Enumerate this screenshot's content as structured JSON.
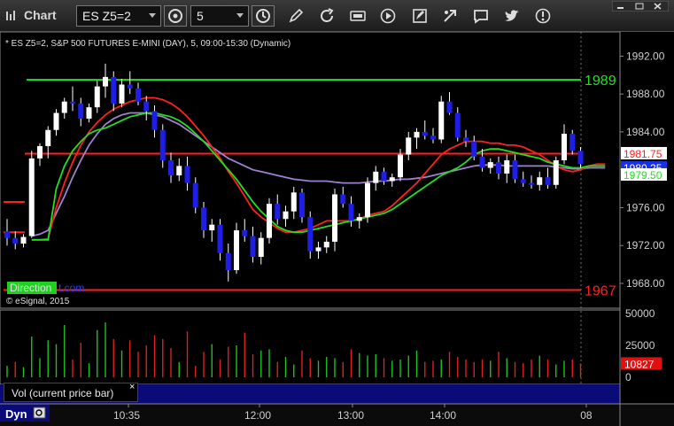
{
  "window": {
    "title": "Chart",
    "symbol": "ES Z5=2",
    "interval": "5"
  },
  "toolbar_icons": [
    "interval-settings-icon",
    "clock-icon",
    "draw-pencil-icon",
    "refresh-icon",
    "get-icon",
    "play-icon",
    "link-icon",
    "chat-icon",
    "twitter-icon",
    "window-controls-icon"
  ],
  "chart_info": {
    "description": "* ES Z5=2, S&P 500 FUTURES E-MINI (DAY), 5, 09:00-15:30 (Dynamic)",
    "copyright": "© eSignal, 2015",
    "direction_badge": "Direction",
    "direction_suffix": "t.com"
  },
  "colors": {
    "bull_candle": "#ffffff",
    "bear_candle": "#1e1ee6",
    "line_red": "#ff2020",
    "line_green": "#20e020",
    "line_purple": "#a080d0",
    "vol_up": "#20c020",
    "vol_down": "#e02020",
    "panel_blue": "#0a0a78"
  },
  "bottom": {
    "dyn_label": "Dyn",
    "vol_label": "Vol (current price bar)",
    "vol_close": "×"
  },
  "chart_data": [
    {
      "type": "candlestick",
      "title": "",
      "y_axis_ticks": [
        "1992.00",
        "1988.00",
        "1984.00",
        "1980.00",
        "1976.00",
        "1972.00",
        "1968.00"
      ],
      "ylim": [
        1966.5,
        1994.0
      ],
      "x_axis_ticks": [
        "10:35",
        "12:00",
        "13:00",
        "14:00",
        "08"
      ],
      "horizontal_levels": [
        {
          "name": "1989",
          "value": 1989.5,
          "color": "#20e020",
          "labeled": true
        },
        {
          "name": "1967",
          "value": 1967.3,
          "color": "#ff2020",
          "labeled": true
        },
        {
          "name": "red-1981.7",
          "value": 1981.7,
          "color": "#ff2020",
          "labeled": false
        },
        {
          "name": "green-1981.7",
          "value": 1981.7,
          "color": "#20e020",
          "labeled": false
        }
      ],
      "price_labels": [
        {
          "text": "1981.75",
          "value": 1981.75,
          "color": "#ff2020"
        },
        {
          "text": "1980.25",
          "value": 1980.25,
          "color": "#2040ff"
        },
        {
          "text": "1979.50",
          "value": 1979.5,
          "color": "#20e020"
        }
      ],
      "candles": [
        [
          1973.5,
          1974.8,
          1972.0,
          1972.8
        ],
        [
          1972.8,
          1973.5,
          1971.6,
          1972.2
        ],
        [
          1972.2,
          1973.2,
          1971.8,
          1972.9
        ],
        [
          1973.0,
          1982.0,
          1972.8,
          1981.2
        ],
        [
          1981.2,
          1982.8,
          1980.4,
          1982.5
        ],
        [
          1982.5,
          1984.6,
          1981.2,
          1984.2
        ],
        [
          1984.2,
          1986.4,
          1983.6,
          1986.0
        ],
        [
          1986.0,
          1987.6,
          1985.4,
          1987.2
        ],
        [
          1987.2,
          1988.8,
          1986.2,
          1987.0
        ],
        [
          1987.0,
          1987.6,
          1984.6,
          1985.4
        ],
        [
          1985.4,
          1987.0,
          1985.0,
          1986.6
        ],
        [
          1986.6,
          1989.4,
          1986.0,
          1988.8
        ],
        [
          1988.8,
          1991.2,
          1987.6,
          1989.8
        ],
        [
          1989.8,
          1990.4,
          1986.2,
          1987.0
        ],
        [
          1987.0,
          1989.6,
          1986.6,
          1989.0
        ],
        [
          1989.0,
          1990.4,
          1988.0,
          1988.6
        ],
        [
          1988.6,
          1989.2,
          1986.8,
          1987.2
        ],
        [
          1987.2,
          1987.8,
          1985.2,
          1986.2
        ],
        [
          1986.2,
          1986.8,
          1983.4,
          1984.2
        ],
        [
          1984.2,
          1984.8,
          1980.2,
          1981.0
        ],
        [
          1981.0,
          1981.8,
          1978.6,
          1979.4
        ],
        [
          1979.4,
          1981.2,
          1978.8,
          1980.4
        ],
        [
          1980.4,
          1981.4,
          1977.8,
          1978.6
        ],
        [
          1978.6,
          1979.2,
          1975.4,
          1976.0
        ],
        [
          1976.0,
          1976.6,
          1972.8,
          1973.6
        ],
        [
          1973.6,
          1974.8,
          1972.4,
          1974.2
        ],
        [
          1974.2,
          1974.8,
          1970.4,
          1971.2
        ],
        [
          1971.2,
          1972.2,
          1968.2,
          1969.4
        ],
        [
          1969.4,
          1974.4,
          1969.0,
          1973.6
        ],
        [
          1973.6,
          1974.8,
          1972.4,
          1973.0
        ],
        [
          1973.0,
          1974.0,
          1970.2,
          1970.8
        ],
        [
          1970.8,
          1973.4,
          1970.0,
          1972.8
        ],
        [
          1972.8,
          1977.0,
          1972.2,
          1976.4
        ],
        [
          1976.4,
          1977.4,
          1974.2,
          1974.8
        ],
        [
          1974.8,
          1976.2,
          1974.0,
          1975.6
        ],
        [
          1975.6,
          1978.2,
          1974.8,
          1977.6
        ],
        [
          1977.6,
          1978.0,
          1974.4,
          1975.0
        ],
        [
          1975.0,
          1975.6,
          1970.6,
          1971.4
        ],
        [
          1971.4,
          1972.4,
          1970.6,
          1971.8
        ],
        [
          1971.8,
          1973.0,
          1971.2,
          1972.4
        ],
        [
          1972.4,
          1978.0,
          1971.4,
          1977.4
        ],
        [
          1977.4,
          1978.2,
          1976.0,
          1976.4
        ],
        [
          1976.4,
          1977.2,
          1974.0,
          1974.6
        ],
        [
          1974.6,
          1975.4,
          1973.8,
          1975.0
        ],
        [
          1975.0,
          1979.2,
          1974.4,
          1978.6
        ],
        [
          1978.6,
          1980.4,
          1977.8,
          1979.8
        ],
        [
          1979.8,
          1980.2,
          1978.4,
          1978.8
        ],
        [
          1978.8,
          1979.6,
          1978.2,
          1979.2
        ],
        [
          1979.2,
          1982.2,
          1978.8,
          1981.6
        ],
        [
          1981.6,
          1984.0,
          1981.0,
          1983.4
        ],
        [
          1983.4,
          1984.4,
          1982.2,
          1984.0
        ],
        [
          1984.0,
          1985.2,
          1983.2,
          1983.6
        ],
        [
          1983.6,
          1984.4,
          1982.8,
          1983.2
        ],
        [
          1983.2,
          1987.8,
          1982.8,
          1987.2
        ],
        [
          1987.2,
          1988.2,
          1985.8,
          1986.0
        ],
        [
          1986.0,
          1986.6,
          1983.0,
          1983.4
        ],
        [
          1983.4,
          1984.2,
          1982.4,
          1983.0
        ],
        [
          1983.0,
          1983.6,
          1981.0,
          1981.4
        ],
        [
          1981.4,
          1982.2,
          1979.8,
          1980.2
        ],
        [
          1980.2,
          1981.2,
          1979.6,
          1980.8
        ],
        [
          1980.8,
          1981.4,
          1979.0,
          1979.6
        ],
        [
          1979.6,
          1981.6,
          1978.6,
          1981.0
        ],
        [
          1981.0,
          1981.6,
          1978.6,
          1979.0
        ],
        [
          1979.0,
          1979.8,
          1978.2,
          1978.6
        ],
        [
          1978.6,
          1979.4,
          1978.0,
          1978.4
        ],
        [
          1978.4,
          1979.8,
          1977.8,
          1979.2
        ],
        [
          1979.2,
          1980.2,
          1978.0,
          1978.4
        ],
        [
          1978.4,
          1981.4,
          1978.0,
          1981.0
        ],
        [
          1981.0,
          1984.8,
          1980.6,
          1983.8
        ],
        [
          1983.8,
          1984.2,
          1981.6,
          1982.0
        ],
        [
          1982.0,
          1982.4,
          1980.2,
          1980.6
        ]
      ],
      "ma_red": [
        1972.6,
        1972.6,
        1972.7,
        1976.0,
        1978.6,
        1980.8,
        1982.6,
        1984.0,
        1985.0,
        1985.8,
        1986.4,
        1986.8,
        1987.2,
        1987.4,
        1987.6,
        1987.6,
        1987.4,
        1987.0,
        1986.4,
        1985.6,
        1984.6,
        1983.6,
        1982.4,
        1981.2,
        1979.8,
        1978.6,
        1977.2,
        1975.8,
        1975.0,
        1974.4,
        1973.8,
        1973.4,
        1973.4,
        1973.6,
        1973.8,
        1974.2,
        1974.6,
        1974.6,
        1974.6,
        1974.6,
        1974.8,
        1975.2,
        1975.4,
        1975.6,
        1976.2,
        1977.0,
        1977.8,
        1978.6,
        1979.6,
        1980.6,
        1981.6,
        1982.2,
        1982.6,
        1983.0,
        1983.0,
        1983.0,
        1982.8,
        1982.8,
        1982.6,
        1982.6,
        1982.4,
        1982.0,
        1981.6,
        1981.0,
        1980.4,
        1980.0,
        1979.8,
        1980.0,
        1980.4,
        1980.6,
        1980.6
      ],
      "ma_green": [
        1972.6,
        1972.6,
        1972.6,
        1978.0,
        1980.4,
        1982.0,
        1983.0,
        1983.8,
        1984.2,
        1984.4,
        1984.8,
        1985.2,
        1985.6,
        1985.8,
        1986.0,
        1986.0,
        1985.8,
        1985.6,
        1985.2,
        1984.6,
        1983.8,
        1983.0,
        1982.0,
        1981.0,
        1980.0,
        1979.0,
        1977.8,
        1976.6,
        1975.6,
        1974.8,
        1974.0,
        1973.6,
        1973.4,
        1973.4,
        1973.6,
        1973.8,
        1974.0,
        1974.2,
        1974.4,
        1974.6,
        1974.8,
        1975.0,
        1975.2,
        1975.4,
        1975.8,
        1976.4,
        1977.0,
        1977.6,
        1978.2,
        1978.8,
        1979.4,
        1979.8,
        1980.2,
        1980.8,
        1981.6,
        1982.0,
        1982.2,
        1982.2,
        1982.0,
        1981.8,
        1981.6,
        1981.4,
        1981.2,
        1980.8,
        1980.6,
        1980.4,
        1980.2,
        1980.2,
        1980.4,
        1980.4,
        1980.4
      ],
      "ma_purple": [
        1973.0,
        1973.2,
        1973.6,
        1975.4,
        1977.2,
        1979.2,
        1981.0,
        1982.6,
        1983.8,
        1984.8,
        1985.4,
        1985.8,
        1986.0,
        1986.0,
        1986.0,
        1985.8,
        1985.6,
        1985.2,
        1984.8,
        1984.2,
        1983.6,
        1983.0,
        1982.4,
        1981.8,
        1981.2,
        1980.8,
        1980.4,
        1980.0,
        1979.8,
        1979.6,
        1979.4,
        1979.2,
        1979.0,
        1978.9,
        1978.8,
        1978.8,
        1978.8,
        1978.7,
        1978.6,
        1978.6,
        1978.6,
        1978.7,
        1978.8,
        1978.8,
        1978.9,
        1979.0,
        1979.0,
        1979.1,
        1979.2,
        1979.4,
        1979.6,
        1979.8,
        1980.0,
        1980.2,
        1980.4,
        1980.5,
        1980.5,
        1980.5,
        1980.4,
        1980.4,
        1980.4,
        1980.4,
        1980.4,
        1980.4,
        1980.3,
        1980.2,
        1980.1,
        1980.1,
        1980.2,
        1980.2,
        1980.2
      ]
    },
    {
      "type": "bar",
      "title": "Vol (current price bar)",
      "y_axis_ticks": [
        "50000",
        "25000",
        "0"
      ],
      "ylim": [
        0,
        50000
      ],
      "current_value_label": "10827",
      "values": [
        9000,
        12000,
        8000,
        32000,
        15000,
        29000,
        26000,
        41000,
        14000,
        27000,
        11000,
        37000,
        43000,
        30000,
        21000,
        29000,
        20000,
        25000,
        33000,
        30000,
        23000,
        12000,
        36000,
        9000,
        20000,
        26000,
        14000,
        24000,
        25000,
        35000,
        18000,
        21000,
        22000,
        12000,
        16000,
        10000,
        21000,
        15000,
        13000,
        16000,
        15000,
        12000,
        22000,
        19000,
        17000,
        18000,
        15000,
        13000,
        14000,
        17000,
        21000,
        12000,
        13000,
        14000,
        20000,
        16000,
        14000,
        12000,
        14000,
        13000,
        20000,
        15000,
        12000,
        11000,
        14000,
        17000,
        14000,
        10000,
        13000,
        14000,
        10827
      ],
      "up": [
        1,
        0,
        1,
        1,
        1,
        1,
        1,
        1,
        0,
        0,
        1,
        1,
        1,
        0,
        1,
        0,
        0,
        0,
        0,
        0,
        0,
        1,
        0,
        0,
        0,
        1,
        0,
        0,
        1,
        0,
        0,
        1,
        1,
        0,
        1,
        1,
        0,
        0,
        1,
        1,
        1,
        0,
        0,
        1,
        1,
        1,
        0,
        1,
        1,
        1,
        1,
        0,
        0,
        1,
        0,
        0,
        0,
        0,
        0,
        1,
        0,
        1,
        0,
        0,
        0,
        1,
        0,
        1,
        1,
        0,
        0
      ]
    }
  ]
}
